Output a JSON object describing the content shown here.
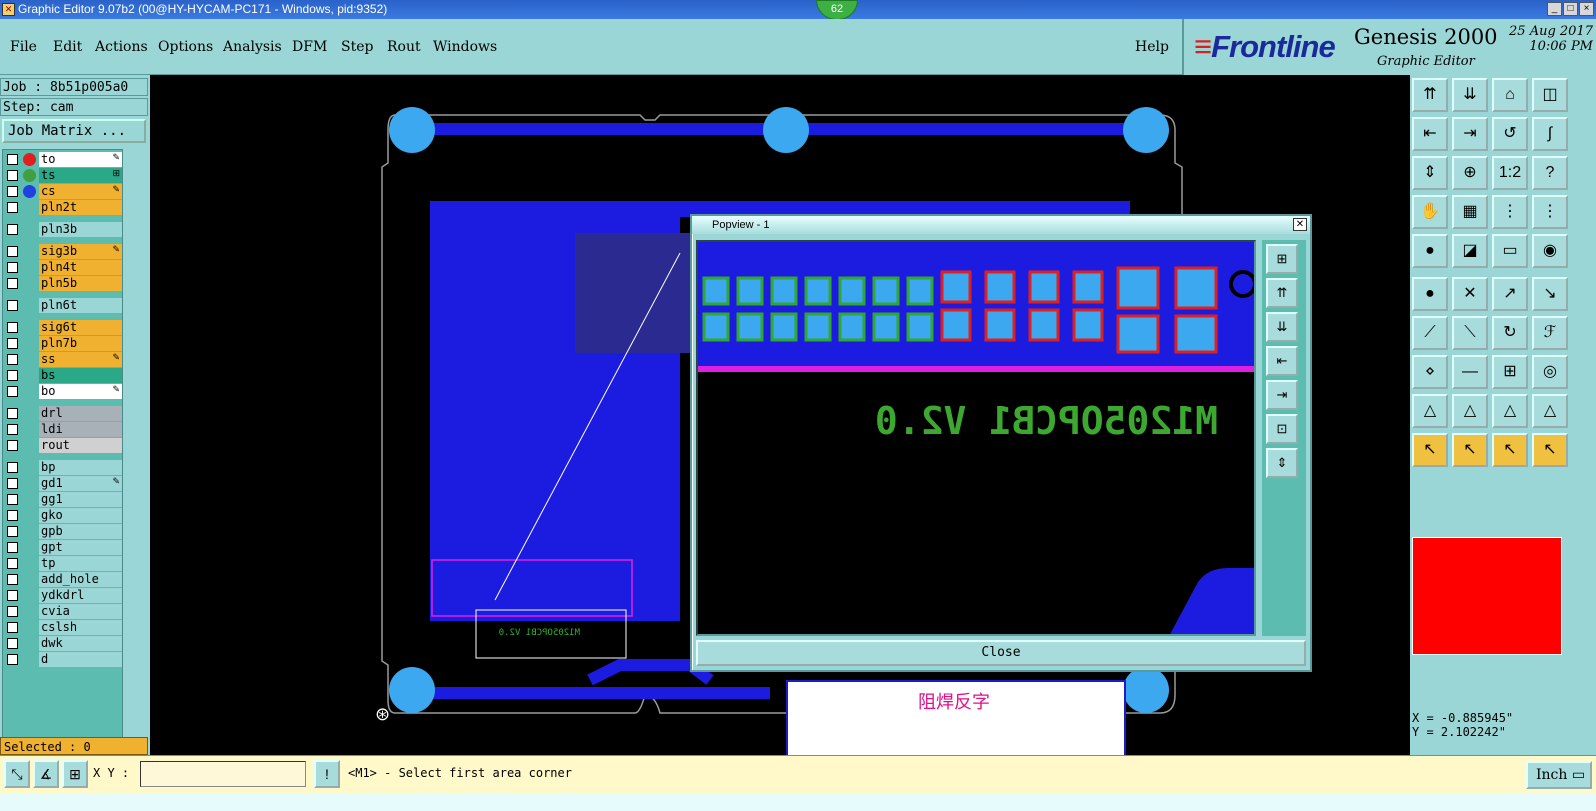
{
  "window": {
    "title": "Graphic Editor 9.07b2 (00@HY-HYCAM-PC171 - Windows, pid:9352)",
    "badge": "62",
    "min": "_",
    "max": "□",
    "close": "×"
  },
  "menu": [
    "File",
    "Edit",
    "Actions",
    "Options",
    "Analysis",
    "DFM",
    "Step",
    "Rout",
    "Windows"
  ],
  "help": "Help",
  "brand": {
    "logo": "Frontline",
    "product": "Genesis 2000",
    "subtitle": "Graphic Editor",
    "date": "25 Aug 2017",
    "time": "10:06 PM"
  },
  "job": {
    "job": "Job : 8b51p005a0",
    "step": "Step: cam",
    "matrix": "Job Matrix ..."
  },
  "layers": [
    {
      "name": "to",
      "color": "#ffffff",
      "dot": "#e02020",
      "mark": "✎"
    },
    {
      "name": "ts",
      "color": "#2aa888",
      "dot": "#40a040",
      "mark": "⊞"
    },
    {
      "name": "cs",
      "color": "#f0b030",
      "dot": "#2040e0",
      "mark": "✎"
    },
    {
      "name": "pln2t",
      "color": "#f0b030",
      "dot": "",
      "mark": ""
    },
    {
      "name": "pln3b",
      "color": "#9ad6d6",
      "dot": "",
      "mark": ""
    },
    {
      "name": "sig3b",
      "color": "#f0b030",
      "dot": "",
      "mark": "✎"
    },
    {
      "name": "pln4t",
      "color": "#f0b030",
      "dot": "",
      "mark": ""
    },
    {
      "name": "pln5b",
      "color": "#f0b030",
      "dot": "",
      "mark": ""
    },
    {
      "name": "pln6t",
      "color": "#9ad6d6",
      "dot": "",
      "mark": ""
    },
    {
      "name": "sig6t",
      "color": "#f0b030",
      "dot": "",
      "mark": ""
    },
    {
      "name": "pln7b",
      "color": "#f0b030",
      "dot": "",
      "mark": ""
    },
    {
      "name": "ss",
      "color": "#f0b030",
      "dot": "",
      "mark": "✎"
    },
    {
      "name": "bs",
      "color": "#2aa888",
      "dot": "",
      "mark": ""
    },
    {
      "name": "bo",
      "color": "#ffffff",
      "dot": "",
      "mark": "✎"
    },
    {
      "name": "drl",
      "color": "#a8b0b8",
      "dot": "",
      "mark": ""
    },
    {
      "name": "ldi",
      "color": "#a8b0b8",
      "dot": "",
      "mark": ""
    },
    {
      "name": "rout",
      "color": "#d0d0d0",
      "dot": "",
      "mark": ""
    },
    {
      "name": "bp",
      "color": "#9ad6d6",
      "dot": "",
      "mark": ""
    },
    {
      "name": "gd1",
      "color": "#9ad6d6",
      "dot": "",
      "mark": "✎"
    },
    {
      "name": "gg1",
      "color": "#9ad6d6",
      "dot": "",
      "mark": ""
    },
    {
      "name": "gko",
      "color": "#9ad6d6",
      "dot": "",
      "mark": ""
    },
    {
      "name": "gpb",
      "color": "#9ad6d6",
      "dot": "",
      "mark": ""
    },
    {
      "name": "gpt",
      "color": "#9ad6d6",
      "dot": "",
      "mark": ""
    },
    {
      "name": "tp",
      "color": "#9ad6d6",
      "dot": "",
      "mark": ""
    },
    {
      "name": "add_hole",
      "color": "#9ad6d6",
      "dot": "",
      "mark": ""
    },
    {
      "name": "ydkdrl",
      "color": "#9ad6d6",
      "dot": "",
      "mark": ""
    },
    {
      "name": "cvia",
      "color": "#9ad6d6",
      "dot": "",
      "mark": ""
    },
    {
      "name": "cslsh",
      "color": "#9ad6d6",
      "dot": "",
      "mark": ""
    },
    {
      "name": "dwk",
      "color": "#9ad6d6",
      "dot": "",
      "mark": ""
    },
    {
      "name": "d",
      "color": "#9ad6d6",
      "dot": "",
      "mark": ""
    }
  ],
  "selected": "Selected : 0",
  "popview": {
    "title": "Popview - 1",
    "silk_text": "M1205OPCB1 V2.0",
    "close": "Close"
  },
  "board_silk": "M1205OPCB1 V2.0",
  "coords": {
    "x": "X = -0.885945\"",
    "y": "Y = 2.102242\""
  },
  "status": {
    "xy_label": "X Y :",
    "prompt": "<M1> - Select first area corner",
    "unit": "Inch",
    "info_icon": "!"
  },
  "note": "阻焊反字",
  "toolbar": [
    "⇈",
    "⇊",
    "⌂",
    "◫",
    "⇤",
    "⇥",
    "↺",
    "∫",
    "⇕",
    "⊕",
    "1:2",
    "?",
    "✋",
    "▦",
    "⋮",
    "⋮",
    "●",
    "◪",
    "▭",
    "◉",
    "●",
    "✕",
    "↗",
    "↘",
    "⟋",
    "⟍",
    "↻",
    "ℱ",
    "⋄",
    "—",
    "⊞",
    "◎",
    "△",
    "△",
    "△",
    "△",
    "↖",
    "↖",
    "↖",
    "↖"
  ]
}
